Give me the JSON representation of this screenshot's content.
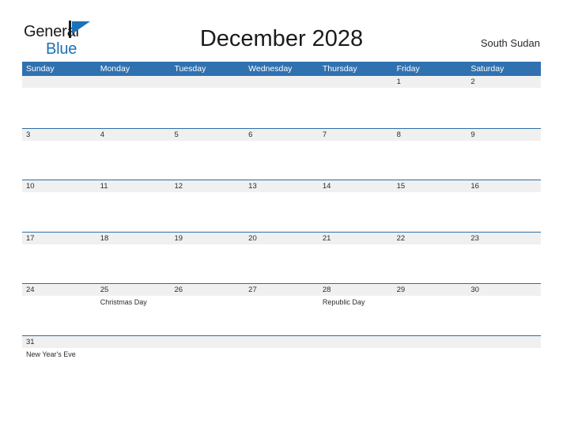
{
  "brand": {
    "name_part1": "General",
    "name_part2": "Blue",
    "flag_icon": "blue-flag-triangle-icon",
    "accent_color": "#1b72b8"
  },
  "header": {
    "title": "December 2028",
    "region": "South Sudan"
  },
  "colors": {
    "header_blue": "#3071b0",
    "row_divider_blue": "#2e6da4",
    "day_band_gray": "#f0f0f0",
    "text": "#2b2b2b"
  },
  "calendar": {
    "weekday_headers": [
      "Sunday",
      "Monday",
      "Tuesday",
      "Wednesday",
      "Thursday",
      "Friday",
      "Saturday"
    ],
    "weeks": [
      {
        "days": [
          {
            "num": "",
            "events": []
          },
          {
            "num": "",
            "events": []
          },
          {
            "num": "",
            "events": []
          },
          {
            "num": "",
            "events": []
          },
          {
            "num": "",
            "events": []
          },
          {
            "num": "1",
            "events": []
          },
          {
            "num": "2",
            "events": []
          }
        ]
      },
      {
        "days": [
          {
            "num": "3",
            "events": []
          },
          {
            "num": "4",
            "events": []
          },
          {
            "num": "5",
            "events": []
          },
          {
            "num": "6",
            "events": []
          },
          {
            "num": "7",
            "events": []
          },
          {
            "num": "8",
            "events": []
          },
          {
            "num": "9",
            "events": []
          }
        ]
      },
      {
        "days": [
          {
            "num": "10",
            "events": []
          },
          {
            "num": "11",
            "events": []
          },
          {
            "num": "12",
            "events": []
          },
          {
            "num": "13",
            "events": []
          },
          {
            "num": "14",
            "events": []
          },
          {
            "num": "15",
            "events": []
          },
          {
            "num": "16",
            "events": []
          }
        ]
      },
      {
        "days": [
          {
            "num": "17",
            "events": []
          },
          {
            "num": "18",
            "events": []
          },
          {
            "num": "19",
            "events": []
          },
          {
            "num": "20",
            "events": []
          },
          {
            "num": "21",
            "events": []
          },
          {
            "num": "22",
            "events": []
          },
          {
            "num": "23",
            "events": []
          }
        ]
      },
      {
        "days": [
          {
            "num": "24",
            "events": []
          },
          {
            "num": "25",
            "events": [
              "Christmas Day"
            ]
          },
          {
            "num": "26",
            "events": []
          },
          {
            "num": "27",
            "events": []
          },
          {
            "num": "28",
            "events": [
              "Republic Day"
            ]
          },
          {
            "num": "29",
            "events": []
          },
          {
            "num": "30",
            "events": []
          }
        ]
      },
      {
        "days": [
          {
            "num": "31",
            "events": [
              "New Year's Eve"
            ]
          },
          {
            "num": "",
            "events": []
          },
          {
            "num": "",
            "events": []
          },
          {
            "num": "",
            "events": []
          },
          {
            "num": "",
            "events": []
          },
          {
            "num": "",
            "events": []
          },
          {
            "num": "",
            "events": []
          }
        ]
      }
    ]
  }
}
